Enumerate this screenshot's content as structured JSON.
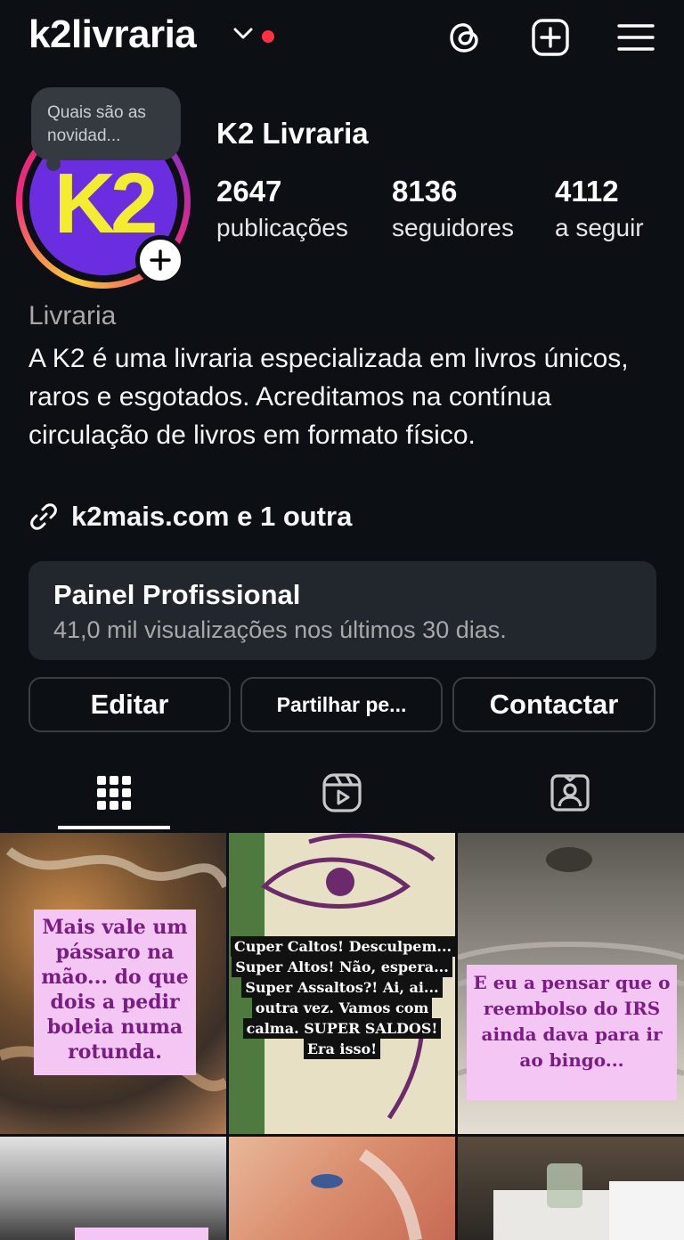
{
  "header": {
    "username": "k2livraria",
    "colors": {
      "notification_dot": "#ff3040",
      "background": "#0c1014"
    },
    "icons": [
      "chevron-down-icon",
      "threads-icon",
      "create-post-icon",
      "menu-icon"
    ]
  },
  "profile": {
    "note": "Quais são as novidad...",
    "avatar_text": "K2",
    "display_name": "K2 Livraria",
    "stats": [
      {
        "value": "2647",
        "label": "publicações"
      },
      {
        "value": "8136",
        "label": "seguidores"
      },
      {
        "value": "4112",
        "label": "a seguir"
      }
    ],
    "category": "Livraria",
    "bio": "A K2 é uma livraria especializada em livros únicos, raros e esgotados. Acreditamos na contínua circulação de livros em formato físico.",
    "link": "k2mais.com e 1 outra"
  },
  "dashboard": {
    "title": "Painel Profissional",
    "subtitle": "41,0 mil visualizações nos últimos 30 dias."
  },
  "actions": {
    "edit": "Editar",
    "share": "Partilhar pe...",
    "contact": "Contactar"
  },
  "tabs": [
    "grid-icon",
    "reels-icon",
    "tagged-icon"
  ],
  "posts": [
    {
      "caption": "Mais vale um pássaro na mão... do que dois a pedir boleia numa rotunda."
    },
    {
      "caption": "Cuper Caltos! Desculpem... Super Altos! Não, espera... Super Assaltos?! Ai, ai... outra vez. Vamos com calma. SUPER SALDOS! Era isso!"
    },
    {
      "caption": "E eu a pensar que o reembolso do IRS ainda dava para ir ao bingo..."
    },
    {
      "caption": ""
    },
    {
      "caption": ""
    },
    {
      "caption": ""
    }
  ]
}
